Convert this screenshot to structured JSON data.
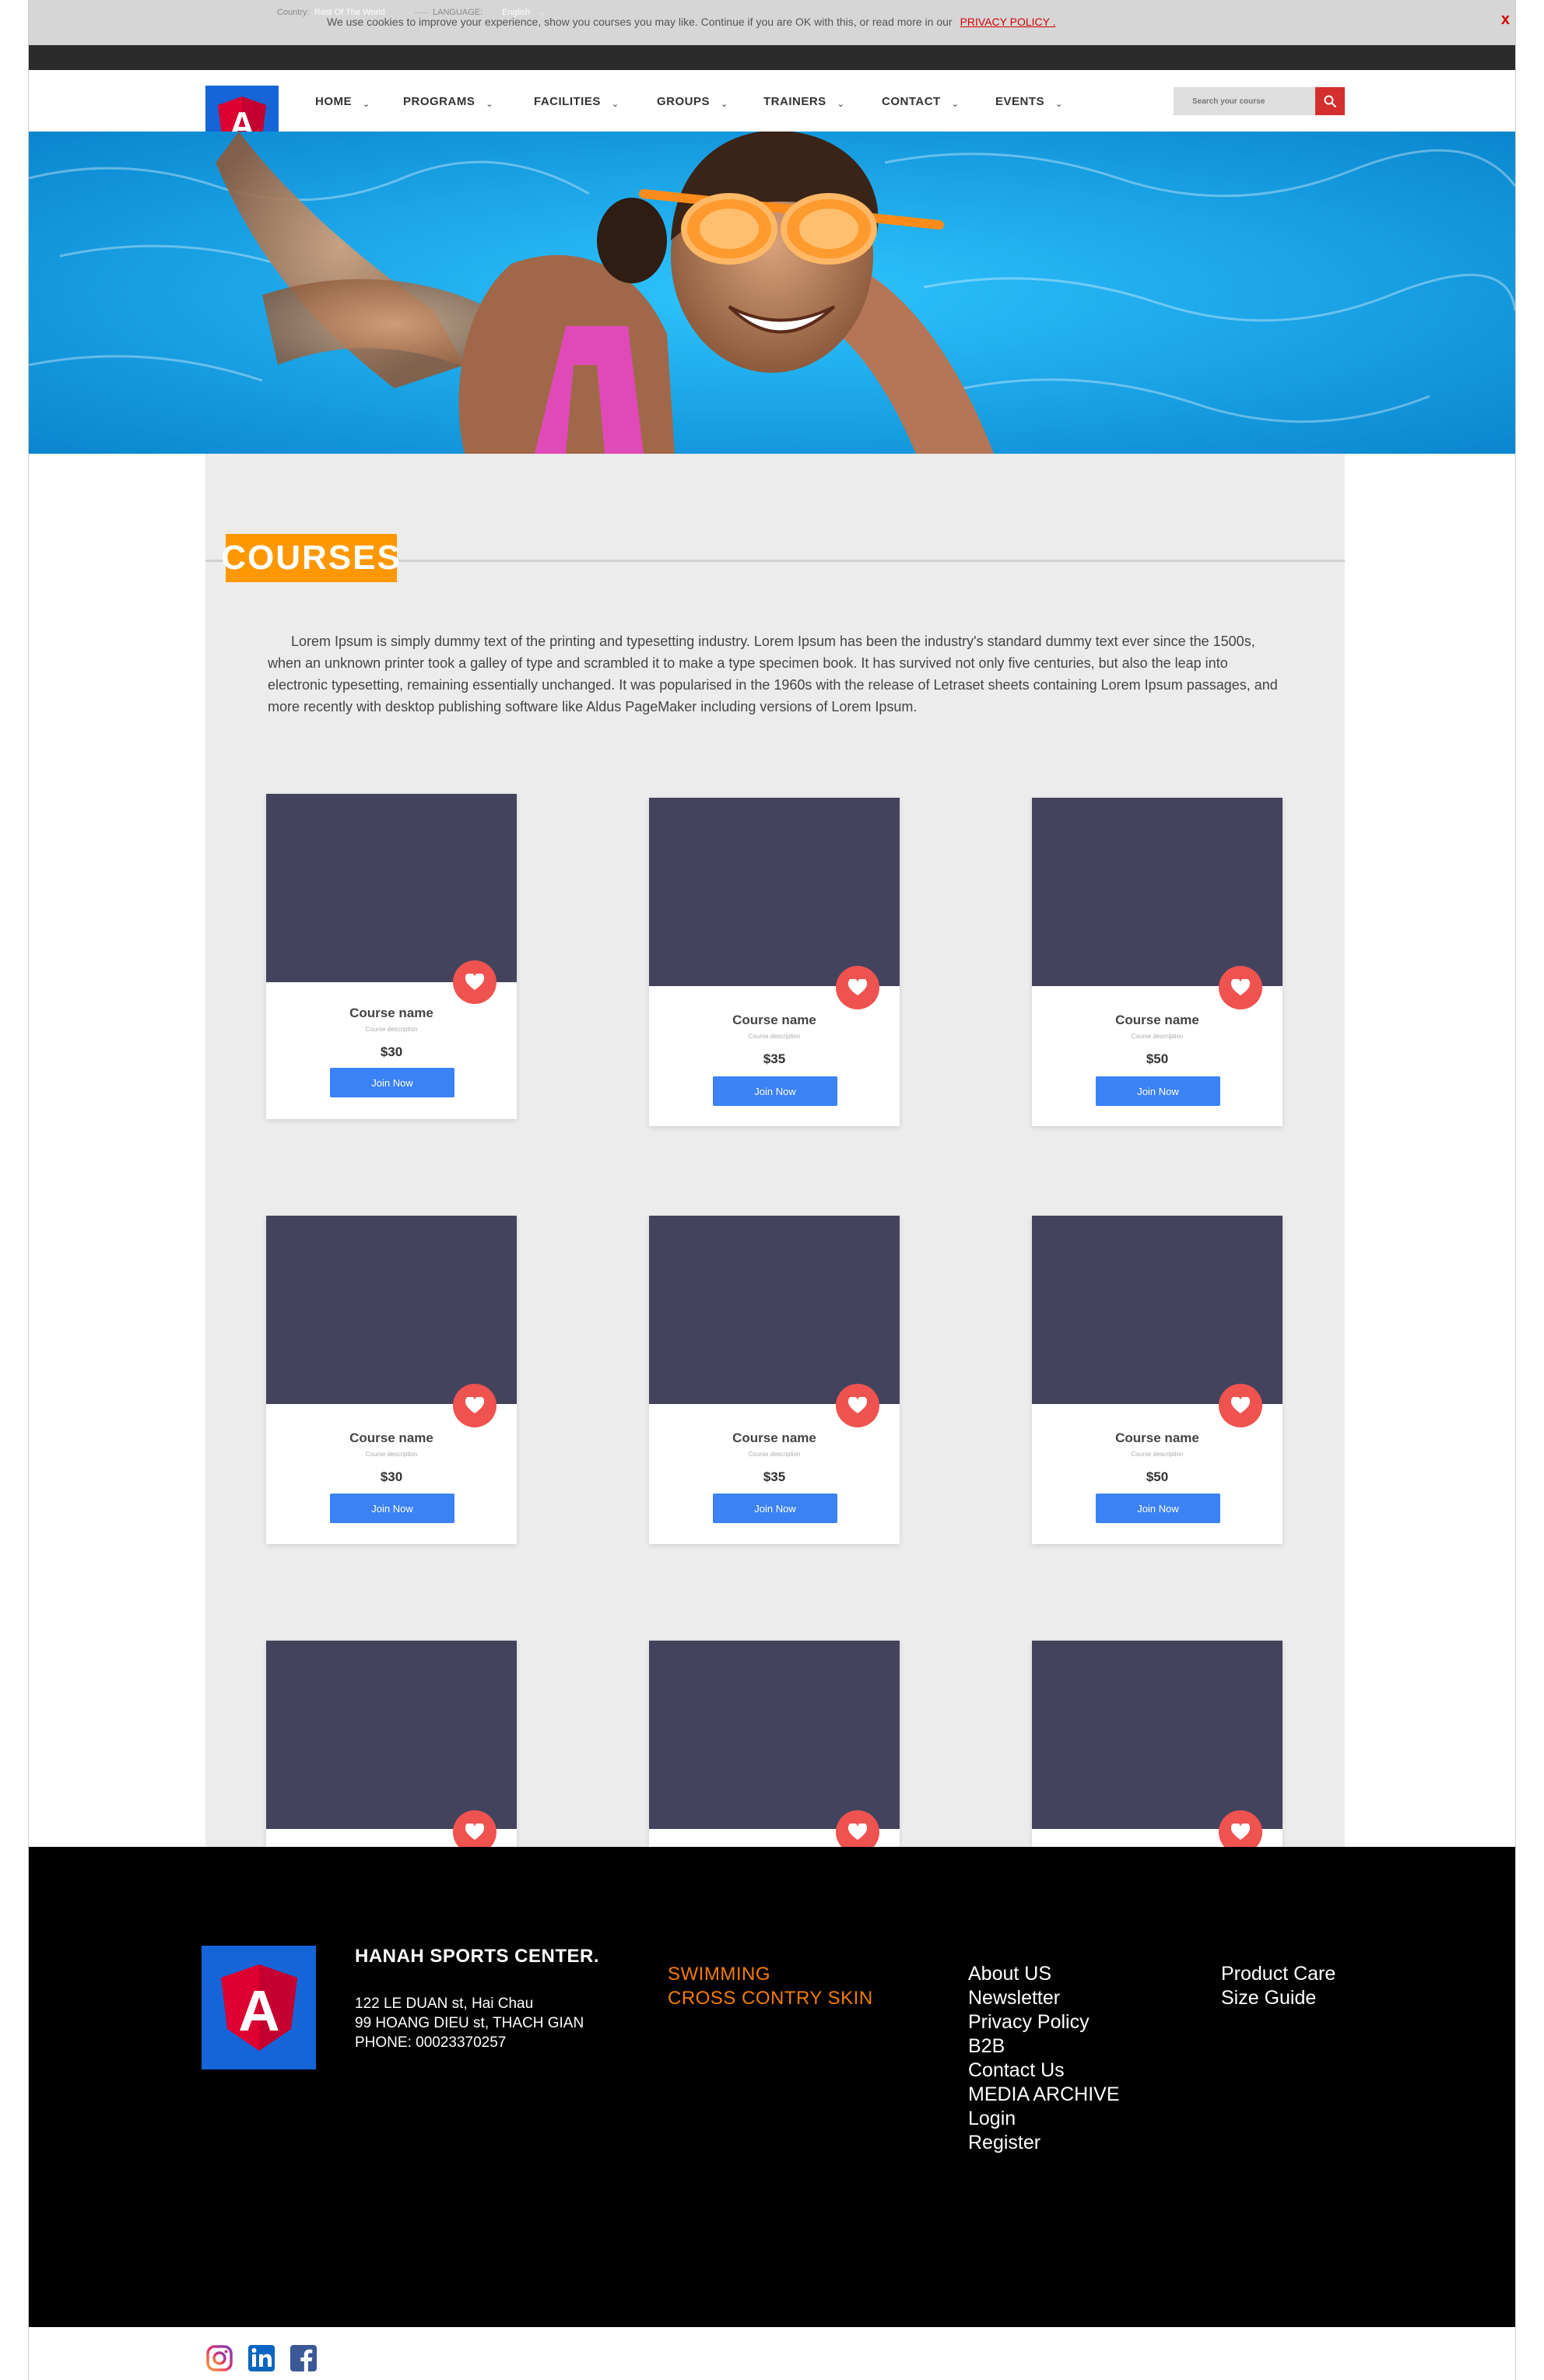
{
  "cookie": {
    "text": "We use cookies to improve your experience, show you courses you may like. Continue if you are OK with this, or read more in our",
    "link": "PRIVACY POLICY .",
    "close": "x"
  },
  "topbar": {
    "country_label": "Country:",
    "country_value": "Rest Of The World",
    "language_label": "LANGUAGE:",
    "language_value": "English"
  },
  "nav": {
    "items": [
      "HOME",
      "PROGRAMS",
      "FACILITIES",
      "GROUPS",
      "TRAINERS",
      "CONTACT",
      "EVENTS"
    ],
    "search_placeholder": "Search your course"
  },
  "courses": {
    "title": "COURSES",
    "intro": "Lorem Ipsum is simply dummy text of the printing and typesetting industry. Lorem Ipsum has been the industry's standard dummy text ever since the 1500s, when an unknown printer took a galley of type and scrambled it to make a type specimen book. It has survived not only five centuries, but also the leap into electronic typesetting, remaining essentially unchanged. It was popularised in the 1960s with the release of Letraset sheets containing Lorem Ipsum passages, and more recently with desktop publishing software like Aldus PageMaker including versions of Lorem Ipsum.",
    "cards": [
      {
        "name": "Course name",
        "description": "Course description",
        "price": "$30",
        "button": "Join Now"
      },
      {
        "name": "Course name",
        "description": "Course description",
        "price": "$35",
        "button": "Join Now"
      },
      {
        "name": "Course name",
        "description": "Course description",
        "price": "$50",
        "button": "Join Now"
      },
      {
        "name": "Course name",
        "description": "Course description",
        "price": "$30",
        "button": "Join Now"
      },
      {
        "name": "Course name",
        "description": "Course description",
        "price": "$35",
        "button": "Join Now"
      },
      {
        "name": "Course name",
        "description": "Course description",
        "price": "$50",
        "button": "Join Now"
      }
    ]
  },
  "footer": {
    "logo_letter": "A",
    "title": "HANAH SPORTS CENTER.",
    "address_lines": [
      "122 LE DUAN st, Hai Chau",
      "99 HOANG DIEU st, THACH GIAN",
      "PHONE: 00023370257"
    ],
    "categories": [
      "SWIMMING",
      "CROSS CONTRY SKIN"
    ],
    "links_col1": [
      "About US",
      "Newsletter",
      "Privacy Policy",
      "B2B",
      "Contact Us",
      "MEDIA ARCHIVE",
      "Login",
      "Register"
    ],
    "links_col2": [
      "Product Care",
      "Size Guide"
    ]
  },
  "social": [
    "instagram-icon",
    "linkedin-icon",
    "facebook-icon"
  ],
  "colors": {
    "accent_orange": "#ff9800",
    "brand_blue": "#1565d8",
    "logo_red": "#dd0031",
    "button_blue": "#3b82f6",
    "heart_red": "#ef5350",
    "card_image": "#43435e",
    "search_button": "#d32f2f"
  }
}
